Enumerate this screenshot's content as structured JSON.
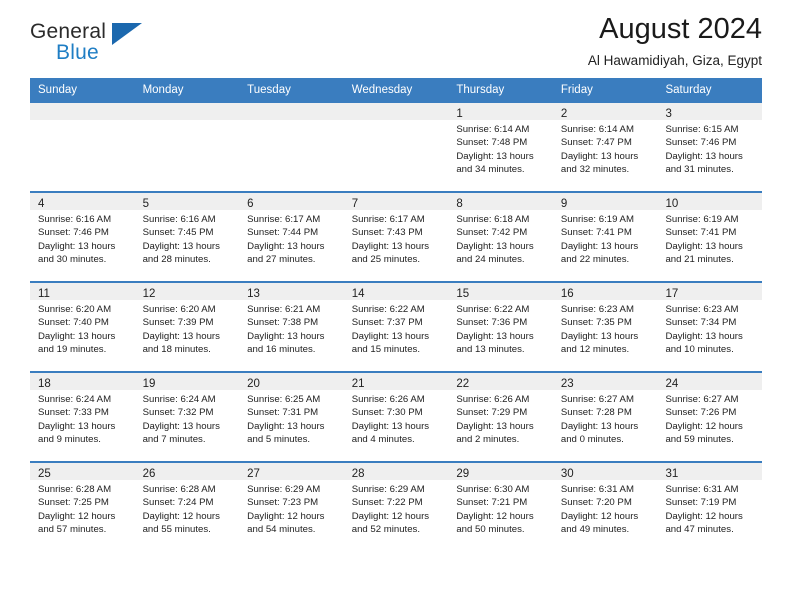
{
  "brand": {
    "name_top": "General",
    "name_bottom": "Blue",
    "accent_color": "#1b68ae",
    "text_color": "#2b2b2b"
  },
  "header": {
    "title": "August 2024",
    "subtitle": "Al Hawamidiyah, Giza, Egypt"
  },
  "theme": {
    "header_row_bg": "#3a7dbf",
    "daynum_band_bg": "#efefef",
    "cell_bg": "#ffffff",
    "text_color": "#222222"
  },
  "calendar": {
    "weekday_headers": [
      "Sunday",
      "Monday",
      "Tuesday",
      "Wednesday",
      "Thursday",
      "Friday",
      "Saturday"
    ],
    "weeks": [
      [
        {
          "day": "",
          "lines": []
        },
        {
          "day": "",
          "lines": []
        },
        {
          "day": "",
          "lines": []
        },
        {
          "day": "",
          "lines": []
        },
        {
          "day": "1",
          "lines": [
            "Sunrise: 6:14 AM",
            "Sunset: 7:48 PM",
            "Daylight: 13 hours",
            "and 34 minutes."
          ]
        },
        {
          "day": "2",
          "lines": [
            "Sunrise: 6:14 AM",
            "Sunset: 7:47 PM",
            "Daylight: 13 hours",
            "and 32 minutes."
          ]
        },
        {
          "day": "3",
          "lines": [
            "Sunrise: 6:15 AM",
            "Sunset: 7:46 PM",
            "Daylight: 13 hours",
            "and 31 minutes."
          ]
        }
      ],
      [
        {
          "day": "4",
          "lines": [
            "Sunrise: 6:16 AM",
            "Sunset: 7:46 PM",
            "Daylight: 13 hours",
            "and 30 minutes."
          ]
        },
        {
          "day": "5",
          "lines": [
            "Sunrise: 6:16 AM",
            "Sunset: 7:45 PM",
            "Daylight: 13 hours",
            "and 28 minutes."
          ]
        },
        {
          "day": "6",
          "lines": [
            "Sunrise: 6:17 AM",
            "Sunset: 7:44 PM",
            "Daylight: 13 hours",
            "and 27 minutes."
          ]
        },
        {
          "day": "7",
          "lines": [
            "Sunrise: 6:17 AM",
            "Sunset: 7:43 PM",
            "Daylight: 13 hours",
            "and 25 minutes."
          ]
        },
        {
          "day": "8",
          "lines": [
            "Sunrise: 6:18 AM",
            "Sunset: 7:42 PM",
            "Daylight: 13 hours",
            "and 24 minutes."
          ]
        },
        {
          "day": "9",
          "lines": [
            "Sunrise: 6:19 AM",
            "Sunset: 7:41 PM",
            "Daylight: 13 hours",
            "and 22 minutes."
          ]
        },
        {
          "day": "10",
          "lines": [
            "Sunrise: 6:19 AM",
            "Sunset: 7:41 PM",
            "Daylight: 13 hours",
            "and 21 minutes."
          ]
        }
      ],
      [
        {
          "day": "11",
          "lines": [
            "Sunrise: 6:20 AM",
            "Sunset: 7:40 PM",
            "Daylight: 13 hours",
            "and 19 minutes."
          ]
        },
        {
          "day": "12",
          "lines": [
            "Sunrise: 6:20 AM",
            "Sunset: 7:39 PM",
            "Daylight: 13 hours",
            "and 18 minutes."
          ]
        },
        {
          "day": "13",
          "lines": [
            "Sunrise: 6:21 AM",
            "Sunset: 7:38 PM",
            "Daylight: 13 hours",
            "and 16 minutes."
          ]
        },
        {
          "day": "14",
          "lines": [
            "Sunrise: 6:22 AM",
            "Sunset: 7:37 PM",
            "Daylight: 13 hours",
            "and 15 minutes."
          ]
        },
        {
          "day": "15",
          "lines": [
            "Sunrise: 6:22 AM",
            "Sunset: 7:36 PM",
            "Daylight: 13 hours",
            "and 13 minutes."
          ]
        },
        {
          "day": "16",
          "lines": [
            "Sunrise: 6:23 AM",
            "Sunset: 7:35 PM",
            "Daylight: 13 hours",
            "and 12 minutes."
          ]
        },
        {
          "day": "17",
          "lines": [
            "Sunrise: 6:23 AM",
            "Sunset: 7:34 PM",
            "Daylight: 13 hours",
            "and 10 minutes."
          ]
        }
      ],
      [
        {
          "day": "18",
          "lines": [
            "Sunrise: 6:24 AM",
            "Sunset: 7:33 PM",
            "Daylight: 13 hours",
            "and 9 minutes."
          ]
        },
        {
          "day": "19",
          "lines": [
            "Sunrise: 6:24 AM",
            "Sunset: 7:32 PM",
            "Daylight: 13 hours",
            "and 7 minutes."
          ]
        },
        {
          "day": "20",
          "lines": [
            "Sunrise: 6:25 AM",
            "Sunset: 7:31 PM",
            "Daylight: 13 hours",
            "and 5 minutes."
          ]
        },
        {
          "day": "21",
          "lines": [
            "Sunrise: 6:26 AM",
            "Sunset: 7:30 PM",
            "Daylight: 13 hours",
            "and 4 minutes."
          ]
        },
        {
          "day": "22",
          "lines": [
            "Sunrise: 6:26 AM",
            "Sunset: 7:29 PM",
            "Daylight: 13 hours",
            "and 2 minutes."
          ]
        },
        {
          "day": "23",
          "lines": [
            "Sunrise: 6:27 AM",
            "Sunset: 7:28 PM",
            "Daylight: 13 hours",
            "and 0 minutes."
          ]
        },
        {
          "day": "24",
          "lines": [
            "Sunrise: 6:27 AM",
            "Sunset: 7:26 PM",
            "Daylight: 12 hours",
            "and 59 minutes."
          ]
        }
      ],
      [
        {
          "day": "25",
          "lines": [
            "Sunrise: 6:28 AM",
            "Sunset: 7:25 PM",
            "Daylight: 12 hours",
            "and 57 minutes."
          ]
        },
        {
          "day": "26",
          "lines": [
            "Sunrise: 6:28 AM",
            "Sunset: 7:24 PM",
            "Daylight: 12 hours",
            "and 55 minutes."
          ]
        },
        {
          "day": "27",
          "lines": [
            "Sunrise: 6:29 AM",
            "Sunset: 7:23 PM",
            "Daylight: 12 hours",
            "and 54 minutes."
          ]
        },
        {
          "day": "28",
          "lines": [
            "Sunrise: 6:29 AM",
            "Sunset: 7:22 PM",
            "Daylight: 12 hours",
            "and 52 minutes."
          ]
        },
        {
          "day": "29",
          "lines": [
            "Sunrise: 6:30 AM",
            "Sunset: 7:21 PM",
            "Daylight: 12 hours",
            "and 50 minutes."
          ]
        },
        {
          "day": "30",
          "lines": [
            "Sunrise: 6:31 AM",
            "Sunset: 7:20 PM",
            "Daylight: 12 hours",
            "and 49 minutes."
          ]
        },
        {
          "day": "31",
          "lines": [
            "Sunrise: 6:31 AM",
            "Sunset: 7:19 PM",
            "Daylight: 12 hours",
            "and 47 minutes."
          ]
        }
      ]
    ]
  }
}
